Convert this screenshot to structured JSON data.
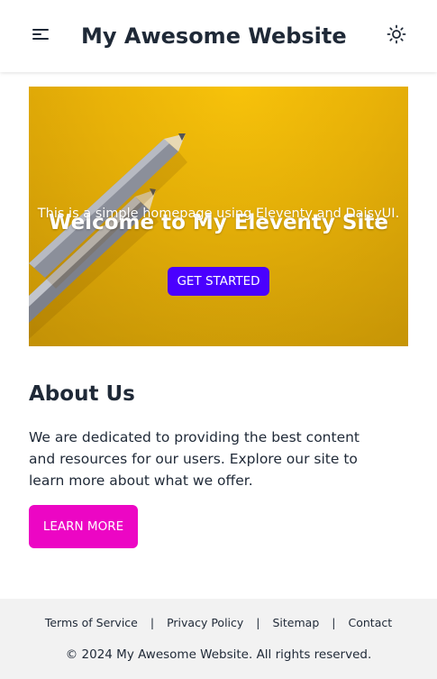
{
  "header": {
    "menu_icon": "hamburger-menu-icon",
    "title": "My Awesome Website",
    "theme_icon": "sun-icon"
  },
  "hero": {
    "title": "Welcome to My Eleventy Site",
    "subtitle": "This is a simple homepage using Eleventy and DaisyUI.",
    "button_label": "GET STARTED",
    "background_image": "pencils-on-yellow-background",
    "colors": {
      "background": "#eab308",
      "button": "#4a00ff"
    }
  },
  "about": {
    "title": "About Us",
    "text": "We are dedicated to providing the best content and resources for our users. Explore our site to learn more about what we offer.",
    "button_label": "LEARN MORE",
    "colors": {
      "button": "#ec06c4"
    }
  },
  "footer": {
    "links": [
      {
        "label": "Terms of Service"
      },
      {
        "label": "Privacy Policy"
      },
      {
        "label": "Sitemap"
      },
      {
        "label": "Contact"
      }
    ],
    "separator": "|",
    "copyright": "© 2024 My Awesome Website. All rights reserved."
  }
}
